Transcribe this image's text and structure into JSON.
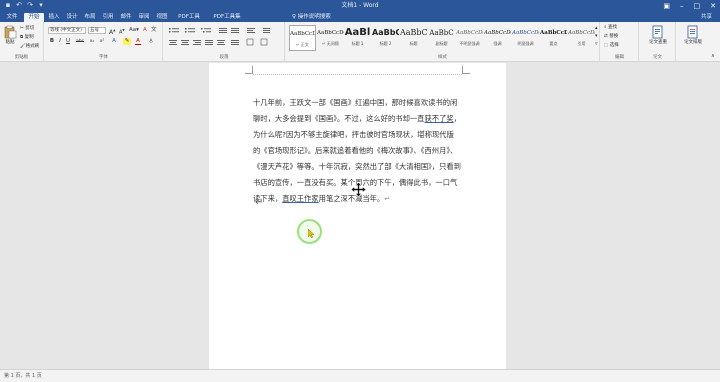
{
  "window": {
    "title": "文档1 - Word",
    "qat": [
      "save-icon",
      "undo-icon",
      "redo-icon",
      "customize-icon"
    ],
    "controls": [
      "restore-icon",
      "minimize-icon",
      "maximize-icon",
      "close-icon"
    ]
  },
  "tabs": [
    "文件",
    "开始",
    "插入",
    "设计",
    "布局",
    "引用",
    "邮件",
    "审阅",
    "视图",
    "PDF工具",
    "PDF工具集"
  ],
  "active_tab": "开始",
  "tell_me": "♀ 操作说明搜索",
  "share": "共享",
  "ribbon": {
    "clipboard": {
      "paste": "粘贴",
      "cut": "剪切",
      "copy": "复制",
      "format_painter": "格式刷",
      "label": "剪贴板"
    },
    "font": {
      "font_name": "等线 (中文正文)",
      "font_size": "五号",
      "label": "字体",
      "buttons": [
        "B",
        "I",
        "U",
        "abc",
        "x₂",
        "x²",
        "A",
        "A"
      ]
    },
    "paragraph": {
      "label": "段落"
    },
    "styles": {
      "label": "样式",
      "items": [
        {
          "preview": "AaBbCcDd",
          "name": "↵ 正文"
        },
        {
          "preview": "AaBbCcDd",
          "name": "↵ 无间隔"
        },
        {
          "preview": "AaBl",
          "name": "标题 1"
        },
        {
          "preview": "AaBbC",
          "name": "标题 2"
        },
        {
          "preview": "AaBbC",
          "name": "标题"
        },
        {
          "preview": "AaBbC",
          "name": "副标题"
        },
        {
          "preview": "AaBbCcDd",
          "name": "不明显强调"
        },
        {
          "preview": "AaBbCcDd",
          "name": "强调"
        },
        {
          "preview": "AaBbCcDd",
          "name": "明显强调"
        },
        {
          "preview": "AaBbCcDd",
          "name": "要点"
        },
        {
          "preview": "AaBbCcDd",
          "name": "引用"
        }
      ]
    },
    "editing": {
      "find": "查找",
      "replace": "替换",
      "select": "选择",
      "label": "编辑"
    },
    "extras": [
      {
        "label": "论文查重",
        "group": "论文"
      },
      {
        "label": "论文排版",
        "group": ""
      }
    ]
  },
  "document": {
    "lines": [
      {
        "segments": [
          {
            "text": "十几年前，王跃文一部《国画》红遍中国，那时候喜欢读书的闲"
          }
        ]
      },
      {
        "segments": [
          {
            "text": "聊时，大多会提到《国画》。不过，这么好的书却一直"
          },
          {
            "text": "获不了奖",
            "underline": true
          },
          {
            "text": "，"
          }
        ]
      },
      {
        "segments": [
          {
            "text": "为什么呢?因为不够主旋律吧，抨击彼时官场现状，堪称现代版"
          }
        ]
      },
      {
        "segments": [
          {
            "text": "的《官场现形记》。后来就追着看他的《梅次故事》、《西州月》、"
          }
        ]
      },
      {
        "segments": [
          {
            "text": "《漫天芦花》等等。十年沉寂，突然出了部《大清相国》，只看到"
          }
        ]
      },
      {
        "segments": [
          {
            "text": "书店的宣传，一直没有买。某个周六的下午，偶得此书，一口气"
          }
        ]
      },
      {
        "segments": [
          {
            "text": "读下来，"
          },
          {
            "text": "直叹王作家",
            "underline": true
          },
          {
            "text": "用笔之深不减当年。"
          },
          {
            "text": "↵",
            "mark": true
          }
        ]
      }
    ],
    "empty_paragraph": "↵"
  },
  "status": "第 1 页，共 1 页"
}
